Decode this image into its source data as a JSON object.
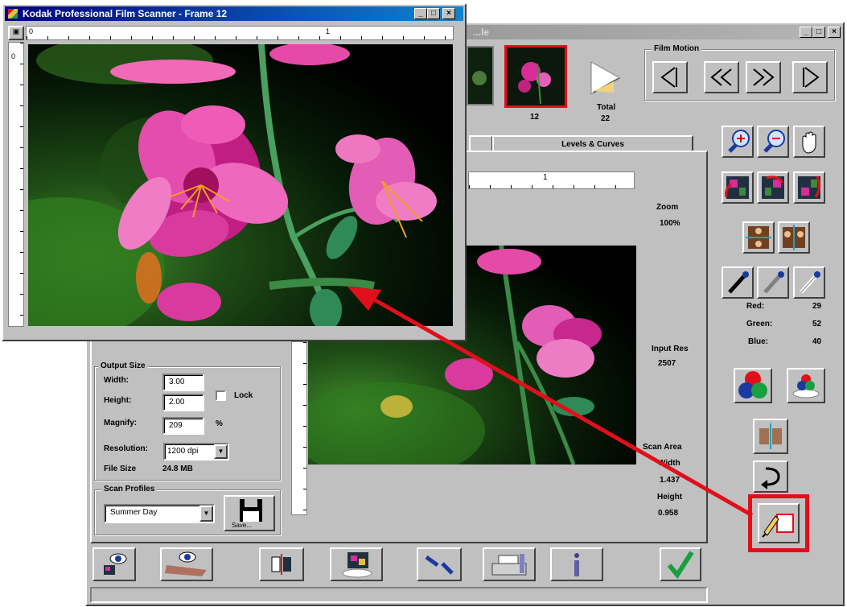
{
  "back_window": {
    "title": "...le",
    "film_motion": {
      "title": "Film Motion"
    },
    "frame_number": "12",
    "total_label": "Total",
    "total_value": "22",
    "tabs": {
      "levels": "Levels & Curves"
    },
    "ruler_mark": "1",
    "zoom_label": "Zoom",
    "zoom_value": "100%",
    "input_res_label": "Input Res",
    "input_res_value": "2507",
    "scan_area_label": "Scan Area",
    "width_label": "Width",
    "width_value": "1.437",
    "height_label": "Height",
    "height_value": "0.958",
    "output_size": {
      "title": "Output Size",
      "width_label": "Width:",
      "width_value": "3.00",
      "height_label": "Height:",
      "height_value": "2.00",
      "lock_label": "Lock",
      "magnify_label": "Magnify:",
      "magnify_value": "209",
      "percent": "%",
      "resolution_label": "Resolution:",
      "resolution_value": "1200 dpi",
      "file_size_label": "File Size",
      "file_size_value": "24.8 MB"
    },
    "scan_profiles": {
      "title": "Scan Profiles",
      "selected": "Summer Day",
      "save_label": "Save..."
    },
    "color_readout": {
      "red_label": "Red:",
      "red_value": "29",
      "green_label": "Green:",
      "green_value": "52",
      "blue_label": "Blue:",
      "blue_value": "40"
    }
  },
  "front_window": {
    "title": "Kodak Professional Film Scanner - Frame 12",
    "ruler_start": "0",
    "ruler_mark": "1",
    "v_ruler_start": "0"
  },
  "colors": {
    "title_active": "#000080",
    "title_inactive": "#808080",
    "window_face": "#c0c0c0",
    "highlight_red": "#e0101a"
  }
}
